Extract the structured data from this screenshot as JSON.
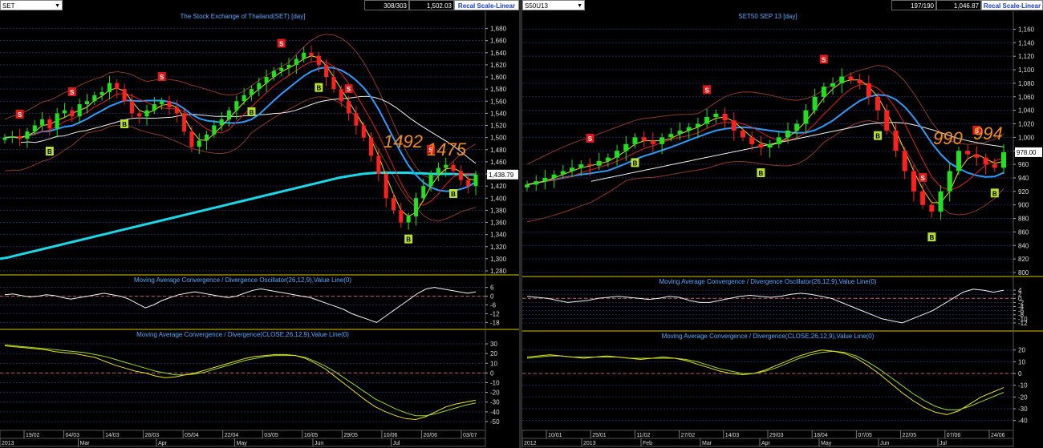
{
  "left": {
    "symbol": "SET",
    "counts": "308/303",
    "last": "1,502.03",
    "recal_label": "Recal Scale-Linear",
    "price_title": "The Stock Exchange of Thailand(SET) [day]",
    "price_label": "1,438.79",
    "annotations": [
      "1492",
      "1475"
    ],
    "osc_title": "Moving Average Convergence / Divergence Oscillator(26,12,9),Value Line(0)",
    "macd_title": "Moving Average Convergence / Divergence(CLOSE,26,12,9),Value Line(0)",
    "date_ticks": [
      "19/02",
      "04/03",
      "14/03",
      "26/03",
      "05/04",
      "22/04",
      "03/05",
      "16/05",
      "29/05",
      "10/06",
      "20/06",
      "03/07"
    ],
    "month_labels": [
      "2013",
      "Mar",
      "Apr",
      "May",
      "Jun",
      "Jul"
    ]
  },
  "right": {
    "symbol": "S50U13",
    "counts": "197/190",
    "last": "1,046.87",
    "recal_label": "Recal Scale-Linear",
    "price_title": "SET50 SEP 13  [day]",
    "price_label": "978.00",
    "annotations": [
      "990",
      "994"
    ],
    "osc_title": "Moving Average Convergence / Divergence Oscillator(26,12,9),Value Line(0)",
    "macd_title": "Moving Average Convergence / Divergence(CLOSE,26,12,9),Value Line(0)",
    "date_ticks": [
      "10/01",
      "25/01",
      "11/02",
      "27/02",
      "14/03",
      "29/03",
      "18/04",
      "07/05",
      "22/05",
      "07/06",
      "24/06"
    ],
    "month_labels": [
      "2012",
      "2013",
      "Feb",
      "Mar",
      "Apr",
      "May",
      "Jun",
      "Jul"
    ]
  },
  "chart_data": [
    {
      "type": "line",
      "title": "The Stock Exchange of Thailand(SET) [day]",
      "ylim": [
        1280,
        1690
      ],
      "y_ticks": [
        1280,
        1300,
        1320,
        1340,
        1360,
        1380,
        1400,
        1420,
        1440,
        1460,
        1480,
        1500,
        1520,
        1540,
        1560,
        1580,
        1600,
        1620,
        1640,
        1660,
        1680
      ],
      "y_tick_labels": [
        "1,280",
        "1,300",
        "1,320",
        "1,340",
        "1,360",
        "1,380",
        "1,400",
        "1,420",
        "1,440",
        "1,460",
        "1,480",
        "1,500",
        "1,520",
        "1,540",
        "1,560",
        "1,580",
        "1,600",
        "1,620",
        "1,640",
        "1,660",
        "1,680"
      ],
      "close": [
        1500,
        1502,
        1498,
        1510,
        1520,
        1530,
        1515,
        1540,
        1545,
        1535,
        1555,
        1560,
        1570,
        1575,
        1590,
        1580,
        1560,
        1540,
        1535,
        1545,
        1555,
        1560,
        1550,
        1540,
        1510,
        1485,
        1495,
        1505,
        1520,
        1530,
        1545,
        1560,
        1570,
        1580,
        1590,
        1600,
        1610,
        1615,
        1620,
        1630,
        1640,
        1635,
        1620,
        1600,
        1580,
        1560,
        1540,
        1520,
        1500,
        1470,
        1440,
        1400,
        1380,
        1360,
        1370,
        1400,
        1420,
        1440,
        1450,
        1455,
        1445,
        1430,
        1420,
        1439
      ],
      "ma200": [
        1300,
        1302,
        1305,
        1308,
        1311,
        1314,
        1317,
        1320,
        1323,
        1326,
        1329,
        1332,
        1335,
        1338,
        1341,
        1344,
        1347,
        1350,
        1353,
        1356,
        1359,
        1362,
        1365,
        1368,
        1371,
        1374,
        1377,
        1380,
        1383,
        1386,
        1389,
        1392,
        1395,
        1398,
        1401,
        1404,
        1407,
        1410,
        1413,
        1416,
        1419,
        1422,
        1425,
        1428,
        1431,
        1434,
        1436,
        1438,
        1440,
        1441,
        1442,
        1442,
        1442,
        1442,
        1442,
        1441,
        1441,
        1440,
        1440,
        1440,
        1440,
        1439,
        1439,
        1439
      ],
      "sell_signals": [
        "S",
        "S",
        "S",
        "S",
        "S",
        "S"
      ],
      "buy_signals": [
        "B",
        "B",
        "B",
        "B",
        "B",
        "B"
      ]
    },
    {
      "type": "line",
      "title": "Moving Average Convergence / Divergence Oscillator(26,12,9),Value Line(0)",
      "ylim": [
        -20,
        8
      ],
      "y_ticks": [
        6,
        0,
        -6,
        -12,
        -18
      ],
      "y_tick_labels": [
        "6",
        "0",
        "-6",
        "-12",
        "-18"
      ],
      "values": [
        1,
        1.5,
        0.5,
        -0.5,
        0,
        1,
        0.5,
        -1,
        -2,
        -1,
        0,
        1,
        2,
        1,
        0,
        -2,
        -5,
        -8,
        -6,
        -3,
        -1,
        1,
        2,
        3,
        2,
        1,
        0,
        -1,
        0,
        2,
        4,
        5,
        4,
        3,
        2,
        1,
        0,
        -1,
        -3,
        -5,
        -7,
        -9,
        -12,
        -14,
        -16,
        -18,
        -14,
        -10,
        -6,
        -2,
        2,
        5,
        6,
        5,
        4,
        3,
        2,
        3
      ]
    },
    {
      "type": "line",
      "title": "Moving Average Convergence / Divergence(CLOSE,26,12,9),Value Line(0)",
      "ylim": [
        -55,
        35
      ],
      "y_ticks": [
        30,
        20,
        10,
        0,
        -10,
        -20,
        -30,
        -40,
        -50
      ],
      "y_tick_labels": [
        "30",
        "20",
        "10",
        "0",
        "-10",
        "-20",
        "-30",
        "-40",
        "-50"
      ],
      "series": [
        {
          "values": [
            28,
            27,
            26,
            25,
            24,
            22,
            21,
            20,
            18,
            16,
            12,
            8,
            5,
            2,
            0,
            -3,
            -5,
            -4,
            -2,
            0,
            3,
            6,
            9,
            12,
            15,
            17,
            18,
            19,
            19,
            18,
            15,
            10,
            4,
            -4,
            -12,
            -20,
            -28,
            -35,
            -40,
            -44,
            -47,
            -48,
            -45,
            -40,
            -35,
            -32,
            -30,
            -28
          ]
        },
        {
          "values": [
            29,
            28,
            27,
            26,
            25,
            24,
            23,
            22,
            21,
            19,
            17,
            14,
            11,
            8,
            5,
            2,
            0,
            -2,
            -2,
            -1,
            1,
            4,
            7,
            10,
            13,
            15,
            17,
            18,
            18,
            18,
            16,
            12,
            7,
            1,
            -6,
            -13,
            -20,
            -27,
            -32,
            -37,
            -41,
            -44,
            -44,
            -42,
            -39,
            -36,
            -33,
            -31
          ]
        }
      ]
    },
    {
      "type": "line",
      "title": "SET50 SEP 13  [day]",
      "ylim": [
        800,
        1170
      ],
      "y_ticks": [
        800,
        820,
        840,
        860,
        880,
        900,
        920,
        940,
        960,
        980,
        1000,
        1020,
        1040,
        1060,
        1080,
        1100,
        1120,
        1140,
        1160
      ],
      "y_tick_labels": [
        "800",
        "820",
        "840",
        "860",
        "880",
        "900",
        "920",
        "940",
        "960",
        "980",
        "1,000",
        "1,020",
        "1,040",
        "1,060",
        "1,080",
        "1,100",
        "1,120",
        "1,140",
        "1,160"
      ],
      "close": [
        930,
        935,
        940,
        945,
        950,
        955,
        960,
        958,
        965,
        970,
        980,
        990,
        1000,
        995,
        990,
        1000,
        1005,
        1010,
        1015,
        1020,
        1030,
        1035,
        1025,
        1010,
        1000,
        990,
        985,
        990,
        1000,
        1010,
        1020,
        1040,
        1060,
        1075,
        1080,
        1090,
        1085,
        1080,
        1060,
        1040,
        1010,
        980,
        950,
        920,
        900,
        890,
        920,
        950,
        980,
        975,
        970,
        960,
        955,
        978
      ],
      "ma200": [
        935,
        938,
        941,
        944,
        947,
        950,
        953,
        956,
        959,
        962,
        965,
        968,
        971,
        974,
        977,
        980,
        983,
        986,
        989,
        992,
        995,
        998,
        1001,
        1004,
        1007,
        1010,
        1013,
        1016,
        1019,
        1021,
        1022,
        1022,
        1021,
        1018,
        1014,
        1010,
        1005,
        1000,
        996,
        993,
        990,
        988,
        986
      ],
      "sell_signals": [
        "S",
        "S",
        "S",
        "S",
        "S"
      ],
      "buy_signals": [
        "B",
        "B",
        "B",
        "B",
        "B"
      ]
    },
    {
      "type": "line",
      "title": "Moving Average Convergence / Divergence Oscillator(26,12,9),Value Line(0)",
      "ylim": [
        -14,
        6
      ],
      "y_ticks": [
        4,
        2,
        0,
        -2,
        -4,
        -6,
        -8,
        -10,
        -12
      ],
      "y_tick_labels": [
        "4",
        "2",
        "0",
        "-2",
        "-4",
        "-6",
        "-8",
        "-10",
        "-12"
      ],
      "values": [
        1,
        0.5,
        0,
        -1,
        -2,
        -1.5,
        -1,
        0,
        0.5,
        1,
        0.5,
        0,
        -0.5,
        0,
        1,
        0.5,
        -1,
        -2,
        -2,
        -1,
        0,
        1,
        1.5,
        1,
        0.5,
        1,
        2,
        2.5,
        2,
        1,
        0,
        -2,
        -4,
        -6,
        -8,
        -10,
        -11,
        -12,
        -10,
        -8,
        -6,
        -3,
        0,
        3,
        4.5,
        4,
        3,
        4
      ]
    },
    {
      "type": "line",
      "title": "Moving Average Convergence / Divergence(CLOSE,26,12,9),Value Line(0)",
      "ylim": [
        -45,
        28
      ],
      "y_ticks": [
        20,
        10,
        0,
        -10,
        -20,
        -30,
        -40
      ],
      "y_tick_labels": [
        "20",
        "10",
        "0",
        "-10",
        "-20",
        "-30",
        "-40"
      ],
      "series": [
        {
          "values": [
            14,
            15,
            16,
            15,
            14,
            13,
            14,
            15,
            14,
            13,
            12,
            13,
            14,
            13,
            11,
            8,
            5,
            2,
            0,
            -1,
            0,
            3,
            7,
            11,
            15,
            18,
            20,
            19,
            17,
            13,
            7,
            0,
            -8,
            -16,
            -23,
            -29,
            -33,
            -35,
            -32,
            -26,
            -20,
            -16,
            -12
          ]
        },
        {
          "values": [
            13,
            14,
            15,
            15,
            14,
            14,
            14,
            14,
            14,
            13,
            13,
            13,
            13,
            13,
            12,
            10,
            7,
            4,
            2,
            0,
            0,
            2,
            5,
            9,
            13,
            16,
            18,
            19,
            18,
            15,
            10,
            4,
            -3,
            -10,
            -17,
            -23,
            -28,
            -31,
            -31,
            -28,
            -24,
            -20,
            -16
          ]
        }
      ]
    }
  ]
}
